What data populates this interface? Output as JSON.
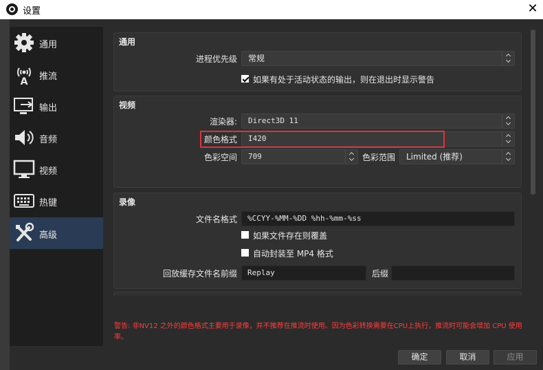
{
  "window": {
    "title": "设置",
    "close_glyph": "✕"
  },
  "sidebar": {
    "items": [
      {
        "label": "通用",
        "icon": "gear-icon"
      },
      {
        "label": "推流",
        "icon": "broadcast-icon"
      },
      {
        "label": "输出",
        "icon": "output-icon"
      },
      {
        "label": "音频",
        "icon": "speaker-icon"
      },
      {
        "label": "视频",
        "icon": "monitor-icon"
      },
      {
        "label": "热键",
        "icon": "keyboard-icon"
      },
      {
        "label": "高级",
        "icon": "tools-icon"
      }
    ],
    "active_index": 6
  },
  "general": {
    "title": "通用",
    "priority_label": "进程优先级",
    "priority_value": "常规",
    "warn_exit_label": "如果有处于活动状态的输出，则在退出时显示警告",
    "warn_exit_checked": true
  },
  "video": {
    "title": "视频",
    "renderer_label": "渲染器:",
    "renderer_value": "Direct3D 11",
    "color_format_label": "颜色格式",
    "color_format_value": "I420",
    "color_space_label": "色彩空间",
    "color_space_value": "709",
    "color_range_label": "色彩范围",
    "color_range_value": "Limited (推荐)"
  },
  "recording": {
    "title": "录像",
    "filename_format_label": "文件名格式",
    "filename_format_value": "%CCYY-%MM-%DD %hh-%mm-%ss",
    "overwrite_label": "如果文件存在则覆盖",
    "overwrite_checked": false,
    "auto_remux_label": "自动封装至 MP4 格式",
    "auto_remux_checked": false,
    "replay_prefix_label": "回放缓存文件名前缀",
    "replay_prefix_value": "Replay",
    "suffix_label": "后缀",
    "suffix_value": ""
  },
  "warning": {
    "text": "警告: 非NV12 之外的颜色格式主要用于录像，并不推荐在推流时使用。因为色彩转换需要在CPU上执行，推流时可能会增加 CPU 使用率。"
  },
  "buttons": {
    "ok": "确定",
    "cancel": "取消",
    "apply": "应用"
  },
  "colors": {
    "highlight": "#e0333d",
    "active_nav": "#2a3c55",
    "warning_text": "#ff3d3d"
  }
}
